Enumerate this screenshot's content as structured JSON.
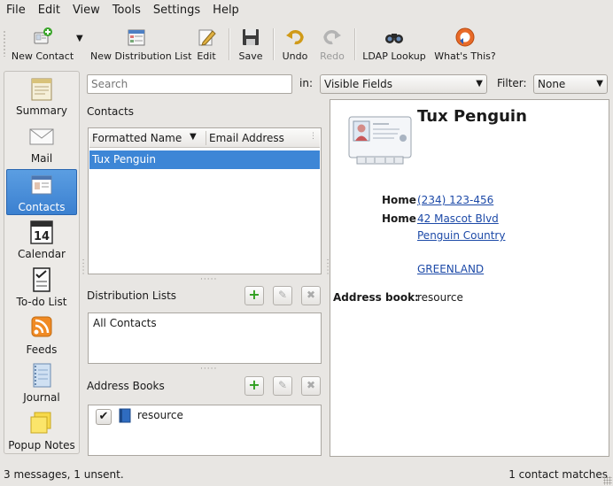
{
  "menu": [
    "File",
    "Edit",
    "View",
    "Tools",
    "Settings",
    "Help"
  ],
  "toolbar": {
    "new_contact": "New Contact",
    "new_distribution_list": "New Distribution List",
    "edit": "Edit",
    "save": "Save",
    "undo": "Undo",
    "redo": "Redo",
    "ldap_lookup": "LDAP Lookup",
    "whats_this": "What's This?"
  },
  "sidebar": {
    "items": [
      {
        "label": "Summary",
        "icon": "summary-icon"
      },
      {
        "label": "Mail",
        "icon": "mail-icon"
      },
      {
        "label": "Contacts",
        "icon": "contacts-icon",
        "active": true
      },
      {
        "label": "Calendar",
        "icon": "calendar-icon",
        "day": "14"
      },
      {
        "label": "To-do List",
        "icon": "todo-icon"
      },
      {
        "label": "Feeds",
        "icon": "feeds-icon"
      },
      {
        "label": "Journal",
        "icon": "journal-icon"
      },
      {
        "label": "Popup Notes",
        "icon": "popup-notes-icon"
      }
    ]
  },
  "search": {
    "placeholder": "Search",
    "in_label": "in:",
    "in_value": "Visible Fields",
    "filter_label": "Filter:",
    "filter_value": "None"
  },
  "contacts": {
    "section_label": "Contacts",
    "columns": [
      "Formatted Name",
      "Email Address"
    ],
    "rows": [
      "Tux Penguin"
    ]
  },
  "distribution_lists": {
    "section_label": "Distribution Lists",
    "items": [
      "All Contacts"
    ]
  },
  "address_books": {
    "section_label": "Address Books",
    "items": [
      {
        "name": "resource",
        "checked": true
      }
    ]
  },
  "detail": {
    "name": "Tux Penguin",
    "phone_label": "Home",
    "phone": "(234) 123-456",
    "address_label": "Home",
    "address_line1": "42 Mascot Blvd",
    "address_line2": "Penguin Country",
    "address_line3": "GREENLAND",
    "addressbook_label": "Address book:",
    "addressbook_value": "resource"
  },
  "status": {
    "left": "3 messages, 1 unsent.",
    "right": "1 contact matches"
  },
  "colors": {
    "selection": "#3d86d6",
    "link": "#1d4aa8",
    "window_bg": "#e8e6e3"
  }
}
